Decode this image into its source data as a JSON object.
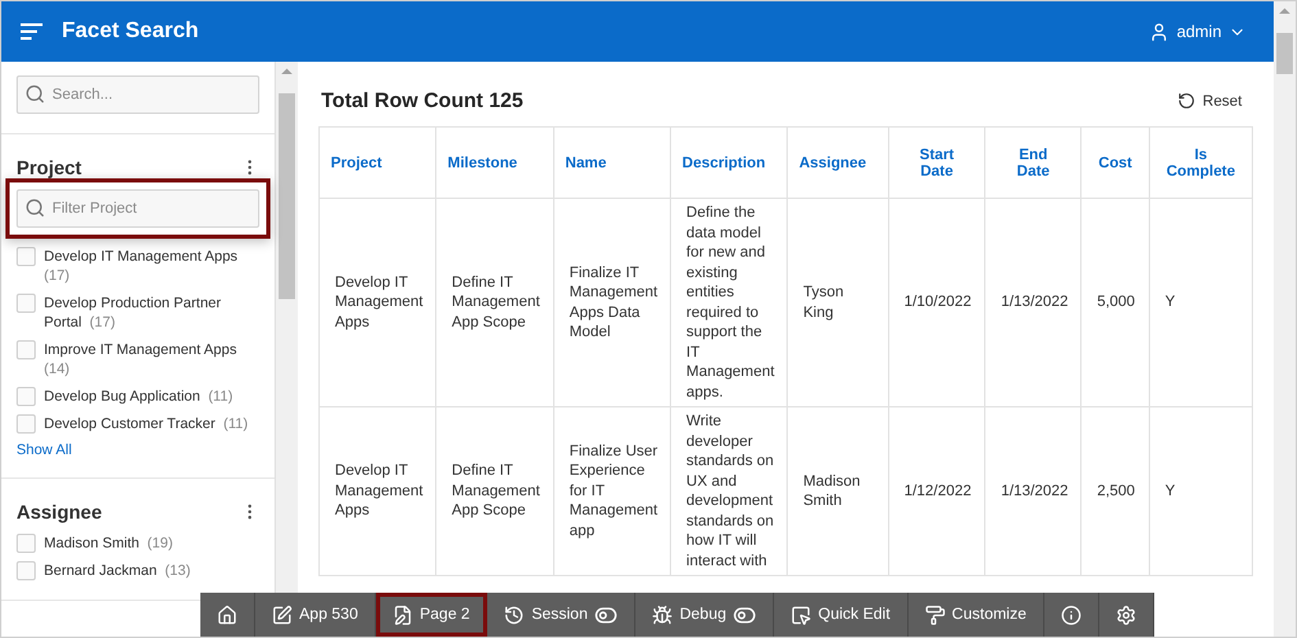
{
  "header": {
    "title": "Facet Search",
    "user": "admin"
  },
  "sidebar": {
    "search_placeholder": "Search...",
    "facets": [
      {
        "title": "Project",
        "filter_placeholder": "Filter Project",
        "highlighted": true,
        "options": [
          {
            "label": "Develop IT Management Apps",
            "count": "(17)",
            "checked": false
          },
          {
            "label": "Develop Production Partner Portal",
            "count": "(17)",
            "checked": false
          },
          {
            "label": "Improve IT Management Apps",
            "count": "(14)",
            "checked": false
          },
          {
            "label": "Develop Bug Application",
            "count": "(11)",
            "checked": false
          },
          {
            "label": "Develop Customer Tracker",
            "count": "(11)",
            "checked": false
          }
        ],
        "show_all": "Show All"
      },
      {
        "title": "Assignee",
        "options": [
          {
            "label": "Madison Smith",
            "count": "(19)",
            "checked": false
          },
          {
            "label": "Bernard Jackman",
            "count": "(13)",
            "checked": false
          }
        ]
      }
    ]
  },
  "main": {
    "title": "Total Row Count 125",
    "reset": "Reset"
  },
  "table": {
    "columns": [
      "Project",
      "Milestone",
      "Name",
      "Description",
      "Assignee",
      "Start Date",
      "End Date",
      "Cost",
      "Is Complete"
    ],
    "rows": [
      [
        "Develop IT Management Apps",
        "Define IT Management App Scope",
        "Finalize IT Management Apps Data Model",
        "Define the data model for new and existing entities required to support the IT Management apps.",
        "Tyson King",
        "1/10/2022",
        "1/13/2022",
        "5,000",
        "Y"
      ],
      [
        "Develop IT Management Apps",
        "Define IT Management App Scope",
        "Finalize User Experience for IT Management app",
        "Write developer standards on UX and development standards on how IT will interact with",
        "Madison Smith",
        "1/12/2022",
        "1/13/2022",
        "2,500",
        "Y"
      ]
    ]
  },
  "toolbar": [
    {
      "kind": "icon",
      "highlighted": false
    },
    {
      "kind": "label",
      "label": "App 530",
      "highlighted": false
    },
    {
      "kind": "label",
      "label": "Page 2",
      "highlighted": true
    },
    {
      "kind": "toggle",
      "label": "Session",
      "highlighted": false
    },
    {
      "kind": "toggle",
      "label": "Debug",
      "highlighted": false
    },
    {
      "kind": "label",
      "label": "Quick Edit",
      "highlighted": false
    },
    {
      "kind": "label",
      "label": "Customize",
      "highlighted": false
    },
    {
      "kind": "icon",
      "highlighted": false
    },
    {
      "kind": "icon",
      "highlighted": false
    }
  ]
}
